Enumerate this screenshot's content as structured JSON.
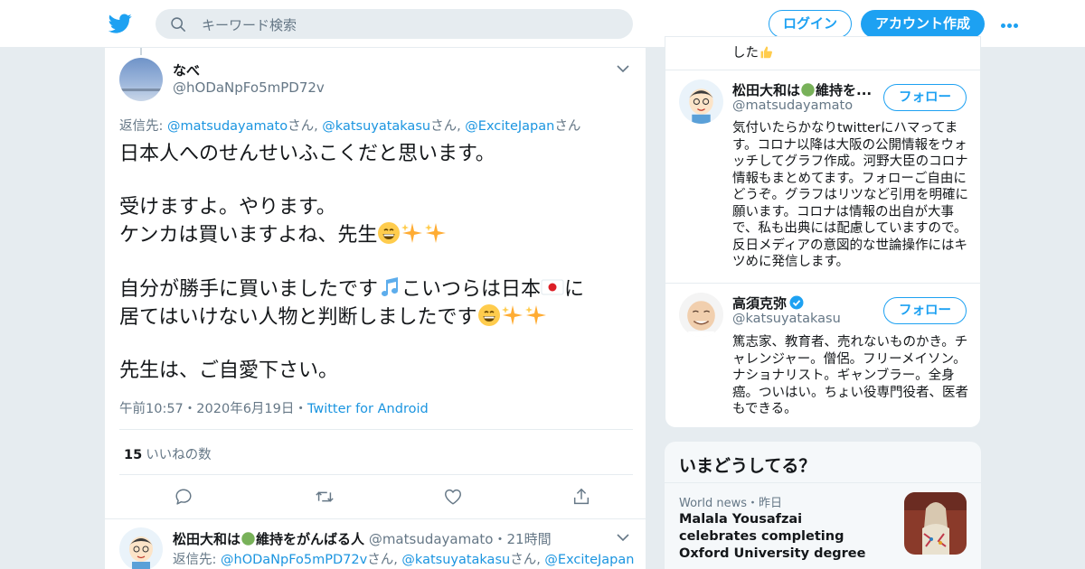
{
  "header": {
    "search_placeholder": "キーワード検索",
    "login_label": "ログイン",
    "signup_label": "アカウント作成",
    "brand_color": "#1da1f2"
  },
  "tweet": {
    "author_name": "なべ",
    "author_handle": "@hODaNpFo5mPD72v",
    "reply_prefix": "返信先: ",
    "reply_users": [
      "@matsudayamato",
      "@katsuyatakasu",
      "@ExciteJapan"
    ],
    "reply_suffix": "さん",
    "reply_sep": ", ",
    "body": {
      "line1": "日本人へのせんせいふこくだと思います。",
      "line2": "受けますよ。やります。",
      "line3": "ケンカは買いますよね、先生",
      "line4a": "自分が勝手に買いましたです",
      "line4b": "こいつらは日本",
      "line4c": "に",
      "line5": "居てはいけない人物と判断しましたです",
      "line6": "先生は、ご自愛下さい。"
    },
    "time": "午前10:57",
    "date": "2020年6月19日",
    "dot": "・",
    "source": "Twitter for Android",
    "likes_count": "15",
    "likes_label": "いいねの数"
  },
  "reply": {
    "author_name": "松田大和は",
    "author_name_rest": "維持をがんばる人",
    "author_handle": "@matsudayamato",
    "dot": "・",
    "time_ago": "21時間",
    "reply_prefix": "返信先: ",
    "reply_user1": "@hODaNpFo5mPD72v",
    "reply_user2": "@katsuyatakasu",
    "reply_user3": "@ExciteJapan",
    "san": "さん",
    "sep": ", "
  },
  "sidebar": {
    "top_text": "した",
    "users": [
      {
        "name": "松田大和は",
        "name_rest": "維持を...",
        "handle": "@matsudayamato",
        "follow_label": "フォロー",
        "bio": "気付いたらかなりtwitterにハマってます。コロナ以降は大阪の公開情報をウォッチしてグラフ作成。河野大臣のコロナ情報もまとめてます。フォローご自由にどうぞ。グラフはリツなど引用を明確に願います。コロナは情報の出自が大事で、私も出典には配慮していますので。反日メディアの意図的な世論操作にはキツめに発信します。"
      },
      {
        "name": "高須克弥",
        "handle": "@katsuyatakasu",
        "follow_label": "フォロー",
        "bio": "篤志家、教育者、売れないものかき。チャレンジャー。僧侶。フリーメイソン。ナショナリスト。ギャンブラー。全身癌。ついはい。ちょい役専門役者、医者もできる。"
      }
    ]
  },
  "trends": {
    "title": "いまどうしてる？",
    "items": [
      {
        "category": "World news",
        "dot": "・",
        "time": "昨日",
        "text": "Malala Yousafzai celebrates completing Oxford University degree"
      }
    ]
  }
}
